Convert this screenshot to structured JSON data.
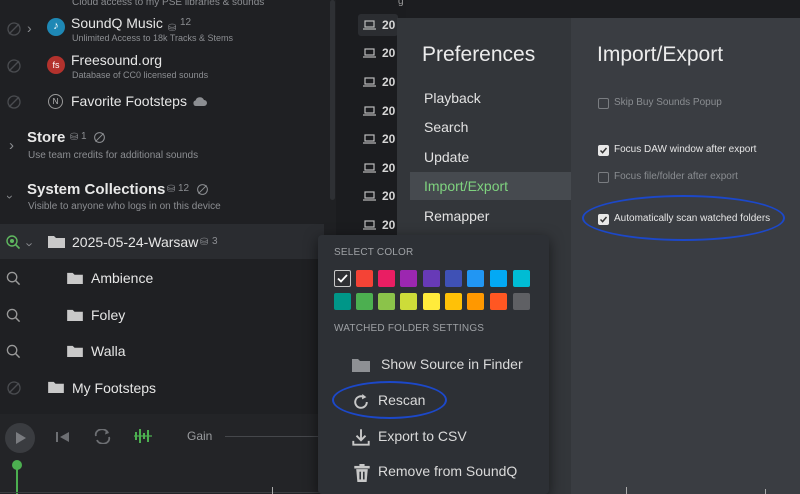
{
  "sidebar": {
    "top_desc": "Cloud access to my PSE libraries & sounds",
    "soundq_music": {
      "title": "SoundQ Music",
      "count": "12",
      "desc": "Unlimited Access to 18k Tracks & Stems"
    },
    "freesound": {
      "title": "Freesound.org",
      "desc": "Database of CC0 licensed sounds",
      "logo": "fs"
    },
    "favorite": {
      "title": "Favorite Footsteps"
    },
    "store": {
      "title": "Store",
      "count": "1",
      "desc": "Use team credits for additional sounds"
    },
    "system": {
      "title": "System Collections",
      "count": "12",
      "desc": "Visible to anyone who logs in on this device"
    },
    "folders": [
      {
        "name": "2025-05-24-Warsaw",
        "count": "3"
      },
      {
        "name": "Ambience"
      },
      {
        "name": "Foley"
      },
      {
        "name": "Walla"
      },
      {
        "name": "My Footsteps"
      }
    ]
  },
  "midlist": {
    "rows": [
      "20",
      "20",
      "20",
      "20",
      "20",
      "20",
      "20",
      "20"
    ],
    "top_fragment": "g"
  },
  "player": {
    "gain_label": "Gain"
  },
  "prefs": {
    "heading": "Preferences",
    "nav": [
      "Playback",
      "Search",
      "Update",
      "Import/Export",
      "Remapper"
    ],
    "active_index": 3,
    "section_title": "Import/Export",
    "options": [
      {
        "label": "Skip Buy Sounds Popup",
        "checked": false
      },
      {
        "label": "Focus DAW window after export",
        "checked": true
      },
      {
        "label": "Focus file/folder after export",
        "checked": false
      },
      {
        "label": "Automatically scan watched folders",
        "checked": true
      }
    ]
  },
  "context_menu": {
    "select_color_label": "SELECT COLOR",
    "watched_label": "WATCHED FOLDER SETTINGS",
    "colors_row1": [
      "#2f3034",
      "#f44336",
      "#e91e63",
      "#9c27b0",
      "#673ab7",
      "#3f51b5",
      "#2196f3",
      "#03a9f4",
      "#00bcd4"
    ],
    "colors_row2": [
      "#009688",
      "#4caf50",
      "#8bc34a",
      "#cddc39",
      "#ffeb3b",
      "#ffc107",
      "#ff9800",
      "#ff5722",
      "#5f6064"
    ],
    "items": [
      {
        "label": "Show Source in Finder",
        "icon": "folder-icon"
      },
      {
        "label": "Rescan",
        "icon": "refresh-icon"
      },
      {
        "label": "Export to CSV",
        "icon": "download-icon"
      },
      {
        "label": "Remove from SoundQ",
        "icon": "trash-icon"
      }
    ]
  },
  "colors": {
    "accent_green": "#7fd37f",
    "annotation_blue": "#1c48c9"
  }
}
